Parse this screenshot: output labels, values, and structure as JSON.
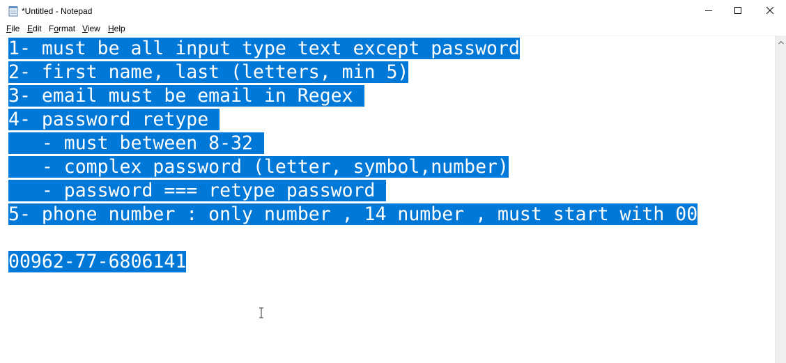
{
  "window": {
    "title": "*Untitled - Notepad"
  },
  "titlebar": {
    "icons": {
      "app": "notepad-icon",
      "minimize": "minimize-icon",
      "maximize": "maximize-icon",
      "close": "close-icon"
    }
  },
  "menu": {
    "file": {
      "access_key": "F",
      "rest": "ile"
    },
    "edit": {
      "access_key": "E",
      "rest": "dit"
    },
    "format": {
      "pre": "F",
      "access_key": "o",
      "rest": "rmat"
    },
    "view": {
      "access_key": "V",
      "rest": "iew"
    },
    "help": {
      "access_key": "H",
      "rest": "elp"
    }
  },
  "editor": {
    "lines": [
      "1- must be all input type text except password",
      "2- first name, last (letters, min 5)",
      "3- email must be email in Regex ",
      "4- password retype ",
      "   - must between 8-32 ",
      "   - complex password (letter, symbol,number)",
      "   - password === retype password ",
      "5- phone number : only number , 14 number , must start with 00",
      "",
      "00962-77-6806141"
    ],
    "selection_color": "#0078d7",
    "cursor": "i-beam-cursor"
  }
}
